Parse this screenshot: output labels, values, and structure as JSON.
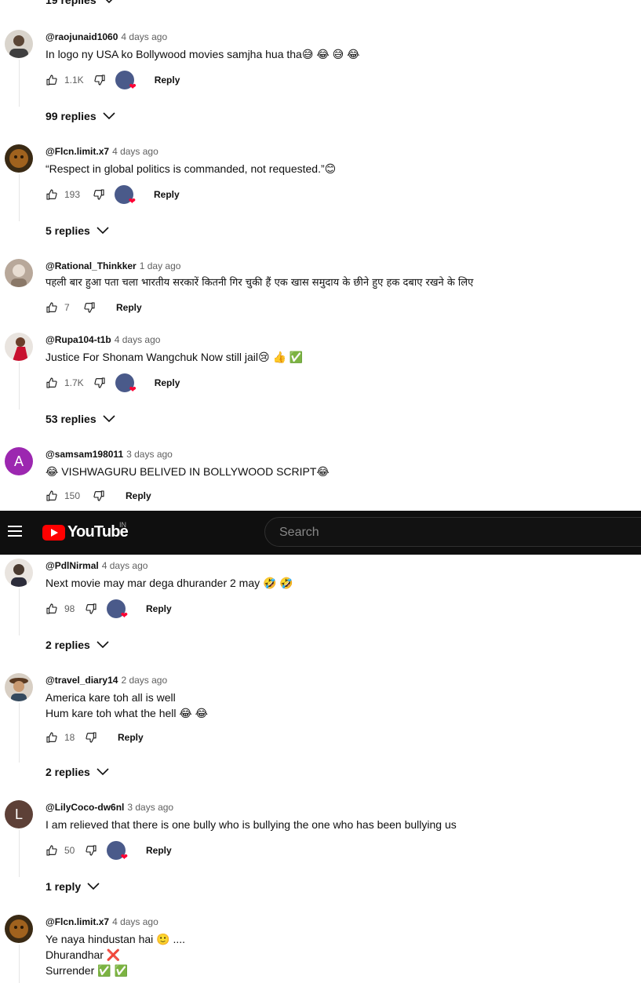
{
  "header": {
    "logo_text": "YouTube",
    "country_code": "IN",
    "search_placeholder": "Search"
  },
  "colors": {
    "brand_red": "#ff0000",
    "header_bg": "#0f0f0f",
    "heart": "#ff0033"
  },
  "top_replies": {
    "label": "19 replies"
  },
  "comments": [
    {
      "author": "@raojunaid1060",
      "time": "4 days ago",
      "lines": [
        "In logo ny USA ko Bollywood movies samjha hua tha😅 😂 😅 😂"
      ],
      "likes": "1.1K",
      "creator_heart": true,
      "reply_label": "Reply",
      "replies": "99 replies"
    },
    {
      "author": "@Flcn.limit.x7",
      "time": "4 days ago",
      "lines": [
        "“Respect in global politics is commanded, not requested.”😊"
      ],
      "likes": "193",
      "creator_heart": true,
      "reply_label": "Reply",
      "replies": "5 replies"
    },
    {
      "author": "@Rational_Thinkker",
      "time": "1 day ago",
      "lines": [
        "पहली बार हुआ पता चला भारतीय सरकारें कितनी गिर चुकी हैं एक खास समुदाय के छीने हुए हक दबाए रखने के लिए"
      ],
      "likes": "7",
      "creator_heart": false,
      "reply_label": "Reply",
      "replies": ""
    },
    {
      "author": "@Rupa104-t1b",
      "time": "4 days ago",
      "lines": [
        "Justice For Shonam Wangchuk Now still jail😢 👍 ✅"
      ],
      "likes": "1.7K",
      "creator_heart": true,
      "reply_label": "Reply",
      "replies": "53 replies"
    },
    {
      "author": "@samsam198011",
      "time": "3 days ago",
      "lines": [
        "😂 VISHWAGURU BELIVED IN BOLLYWOOD SCRIPT😂"
      ],
      "likes": "150",
      "creator_heart": false,
      "reply_label": "Reply",
      "replies": "",
      "avatar_letter": "A"
    },
    {
      "author": "@PdlNirmal",
      "time": "4 days ago",
      "lines": [
        "Next movie may mar dega dhurander 2 may 🤣 🤣"
      ],
      "likes": "98",
      "creator_heart": true,
      "reply_label": "Reply",
      "replies": "2 replies"
    },
    {
      "author": "@travel_diary14",
      "time": "2 days ago",
      "lines": [
        "America kare toh all is well",
        "Hum kare toh what the hell 😂 😂"
      ],
      "likes": "18",
      "creator_heart": false,
      "reply_label": "Reply",
      "replies": "2 replies"
    },
    {
      "author": "@LilyCoco-dw6nl",
      "time": "3 days ago",
      "lines": [
        "I am relieved that there is one bully who is bullying the one who has been bullying us"
      ],
      "likes": "50",
      "creator_heart": true,
      "reply_label": "Reply",
      "replies": "1 reply",
      "avatar_letter": "L"
    },
    {
      "author": "@Flcn.limit.x7",
      "time": "4 days ago",
      "lines": [
        "Ye naya hindustan hai 🙂 ....",
        "Dhurandhar ❌",
        "Surrender ✅ ✅"
      ],
      "likes": "",
      "creator_heart": false,
      "reply_label": "",
      "replies": ""
    }
  ]
}
